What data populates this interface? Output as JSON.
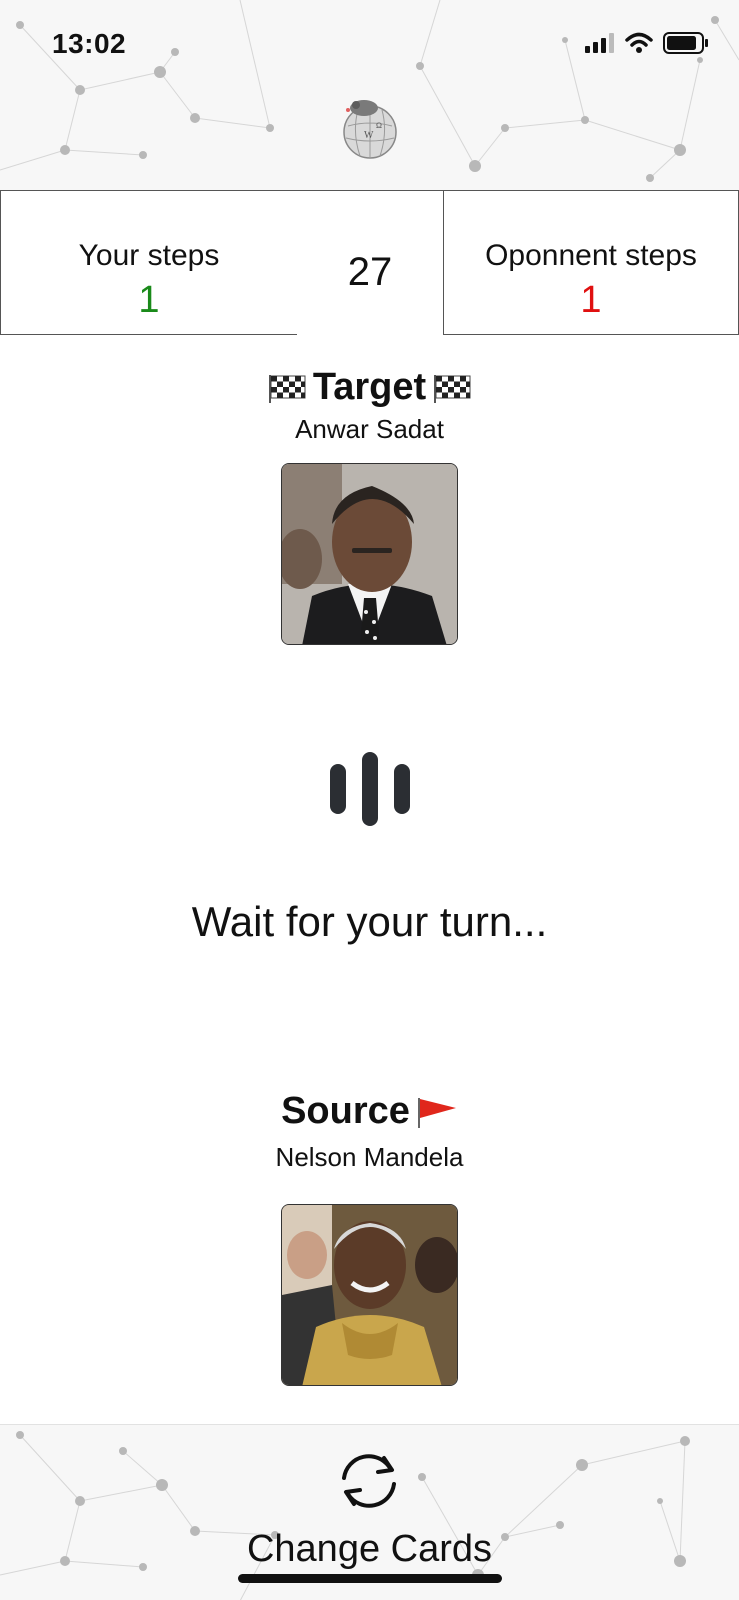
{
  "status_bar": {
    "time": "13:02"
  },
  "score": {
    "your_label": "Your steps",
    "your_value": "1",
    "timer": "27",
    "opponent_label": "Oponnent steps",
    "opponent_value": "1"
  },
  "target": {
    "title": "Target",
    "name": "Anwar Sadat"
  },
  "status_message": "Wait for your turn...",
  "source": {
    "title": "Source",
    "name": "Nelson Mandela"
  },
  "footer": {
    "change_cards_label": "Change Cards"
  },
  "colors": {
    "your_steps": "#1a8a1a",
    "opponent_steps": "#e01010"
  },
  "icons": {
    "logo": "wikipedia-globe-logo-icon",
    "target_flag": "checkered-flag-icon",
    "source_flag": "red-triangular-flag-icon",
    "loader": "loading-bars-icon",
    "change": "refresh-arrows-icon"
  }
}
